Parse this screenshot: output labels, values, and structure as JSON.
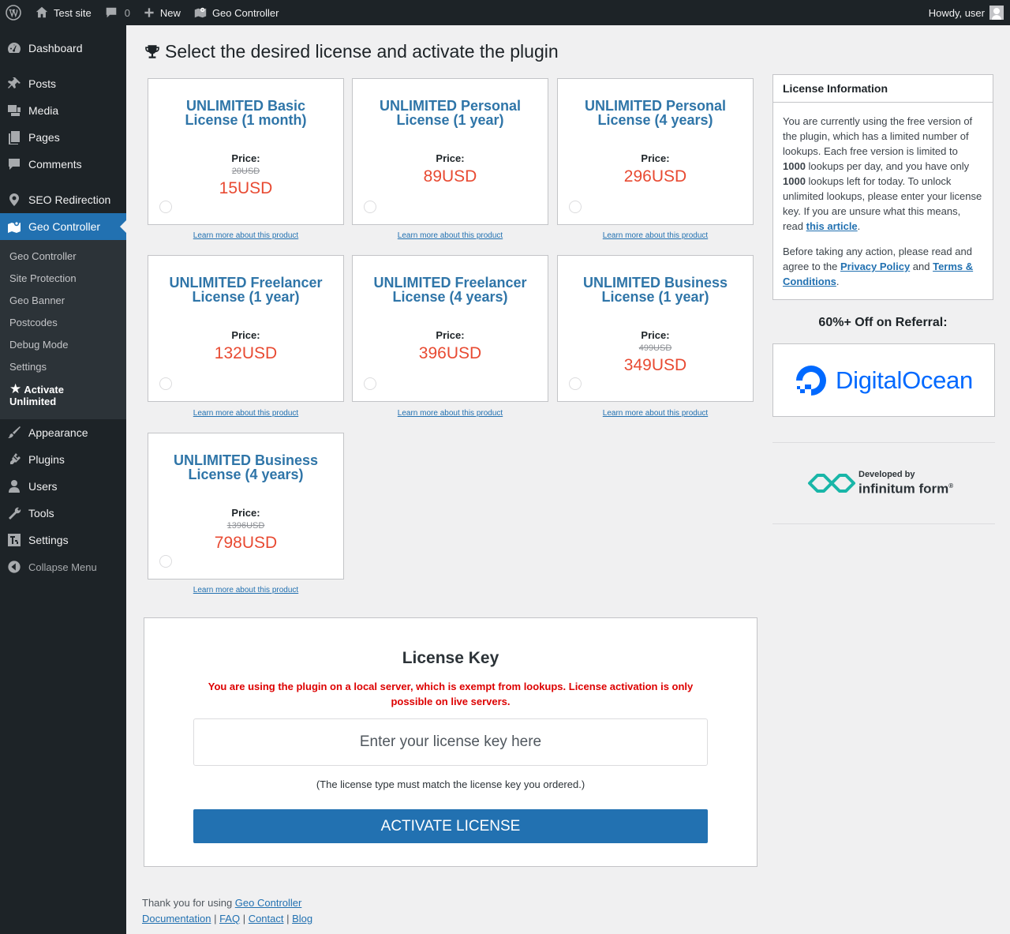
{
  "adminbar": {
    "site_name": "Test site",
    "comments_count": "0",
    "new_label": "New",
    "plugin_label": "Geo Controller",
    "howdy": "Howdy, user"
  },
  "sidebar": {
    "items": [
      {
        "label": "Dashboard",
        "icon": "dashboard-icon"
      },
      {
        "label": "Posts",
        "icon": "pin-icon"
      },
      {
        "label": "Media",
        "icon": "media-icon"
      },
      {
        "label": "Pages",
        "icon": "pages-icon"
      },
      {
        "label": "Comments",
        "icon": "comments-icon"
      },
      {
        "label": "SEO Redirection",
        "icon": "location-icon"
      },
      {
        "label": "Geo Controller",
        "icon": "map-icon"
      },
      {
        "label": "Appearance",
        "icon": "brush-icon"
      },
      {
        "label": "Plugins",
        "icon": "plugin-icon"
      },
      {
        "label": "Users",
        "icon": "users-icon"
      },
      {
        "label": "Tools",
        "icon": "wrench-icon"
      },
      {
        "label": "Settings",
        "icon": "settings-icon"
      }
    ],
    "submenu": [
      "Geo Controller",
      "Site Protection",
      "Geo Banner",
      "Postcodes",
      "Debug Mode",
      "Settings"
    ],
    "submenu_current_line1": "Activate",
    "submenu_current_line2": "Unlimited",
    "collapse": "Collapse Menu"
  },
  "page": {
    "title": "Select the desired license and activate the plugin"
  },
  "licenses": [
    {
      "title": "UNLIMITED Basic License (1 month)",
      "price_label": "Price:",
      "old_price": "20USD",
      "price": "15USD",
      "learn": "Learn more about this product"
    },
    {
      "title": "UNLIMITED Personal License (1 year)",
      "price_label": "Price:",
      "old_price": "",
      "price": "89USD",
      "learn": "Learn more about this product"
    },
    {
      "title": "UNLIMITED Personal License (4 years)",
      "price_label": "Price:",
      "old_price": "",
      "price": "296USD",
      "learn": "Learn more about this product"
    },
    {
      "title": "UNLIMITED Freelancer License (1 year)",
      "price_label": "Price:",
      "old_price": "",
      "price": "132USD",
      "learn": "Learn more about this product"
    },
    {
      "title": "UNLIMITED Freelancer License (4 years)",
      "price_label": "Price:",
      "old_price": "",
      "price": "396USD",
      "learn": "Learn more about this product"
    },
    {
      "title": "UNLIMITED Business License (1 year)",
      "price_label": "Price:",
      "old_price": "499USD",
      "price": "349USD",
      "learn": "Learn more about this product"
    },
    {
      "title": "UNLIMITED Business License (4 years)",
      "price_label": "Price:",
      "old_price": "1396USD",
      "price": "798USD",
      "learn": "Learn more about this product"
    }
  ],
  "info": {
    "heading": "License Information",
    "p1_a": "You are currently using the free version of the plugin, which has a limited number of lookups. Each free version is limited to ",
    "p1_b": "1000",
    "p1_c": " lookups per day, and you have only ",
    "p1_d": "1000",
    "p1_e": " lookups left for today. To unlock unlimited lookups, please enter your license key. If you are unsure what this means, read ",
    "p1_link": "this article",
    "p1_end": ".",
    "p2_a": "Before taking any action, please read and agree to the ",
    "p2_link1": "Privacy Policy",
    "p2_and": " and ",
    "p2_link2": "Terms & Conditions",
    "p2_end": "."
  },
  "referral": {
    "heading": "60%+ Off on Referral:",
    "brand": "DigitalOcean"
  },
  "developer": {
    "small": "Developed by",
    "big": "infinitum form",
    "mark": "®"
  },
  "license_key": {
    "title": "License Key",
    "warning": "You are using the plugin on a local server, which is exempt from lookups. License activation is only possible on live servers.",
    "placeholder": "Enter your license key here",
    "note": "(The license type must match the license key you ordered.)",
    "button": "ACTIVATE LICENSE"
  },
  "footer": {
    "thanks": "Thank you for using ",
    "plugin_link": "Geo Controller",
    "links": [
      "Documentation",
      "FAQ",
      "Contact",
      "Blog"
    ],
    "sep": " | "
  },
  "colors": {
    "accent": "#2271b1",
    "price": "#e84a32",
    "title": "#2f75a8",
    "warning": "#dd0000",
    "digitalocean": "#0069ff",
    "infinitum": "#19b6a8"
  }
}
